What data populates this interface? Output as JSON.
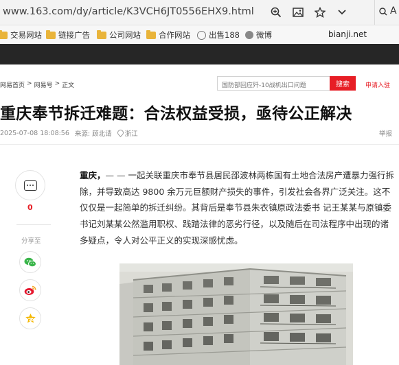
{
  "browser": {
    "url": "www.163.com/dy/article/K3VCH6JT0556EHX9.html",
    "icons": [
      "zoom-icon",
      "image-icon",
      "star-icon",
      "chevron-down-icon",
      "search-icon"
    ],
    "search_letter": "A"
  },
  "bookmarks": [
    {
      "label": "交易网站",
      "icon": "folder"
    },
    {
      "label": "链接广告",
      "icon": "folder"
    },
    {
      "label": "公司网站",
      "icon": "folder"
    },
    {
      "label": "合作网站",
      "icon": "folder"
    },
    {
      "label": "出售188",
      "icon": "globe"
    },
    {
      "label": "微博",
      "icon": "weibo"
    }
  ],
  "watermark": "bianji.net",
  "breadcrumb": {
    "items": [
      "网易首页",
      "网易号",
      "正文"
    ],
    "sep": ">"
  },
  "search": {
    "placeholder": "国防部回应歼-10战机出口问题",
    "button": "搜索"
  },
  "signup": "申请入驻",
  "article": {
    "title": "重庆奉节拆迁难题：合法权益受损，亟待公正解决",
    "datetime": "2025-07-08 18:08:56",
    "source": "来源: 顾北请",
    "location": "浙江",
    "report": "举报",
    "lead": "重庆，",
    "body": "— — 一起关联重庆市奉节县居民邵波林两栋国有土地合法房产遭暴力强行拆除，并导致高达 9800 余万元巨额财产损失的事件，引发社会各界广泛关注。这不仅仅是一起简单的拆迁纠纷。其背后是奉节县朱衣镇原政法委书 记王某某与原镇委书记刘某某公然滥用职权、践踏法律的恶劣行径，以及随后在司法程序中出现的诸多疑点，令人对公平正义的实现深感忧虑。"
  },
  "social": {
    "comment_count": "0",
    "share_label": "分享至"
  },
  "colors": {
    "brand_red": "#e71e25",
    "nav_dark": "#262626",
    "folder": "#e9b43a"
  }
}
